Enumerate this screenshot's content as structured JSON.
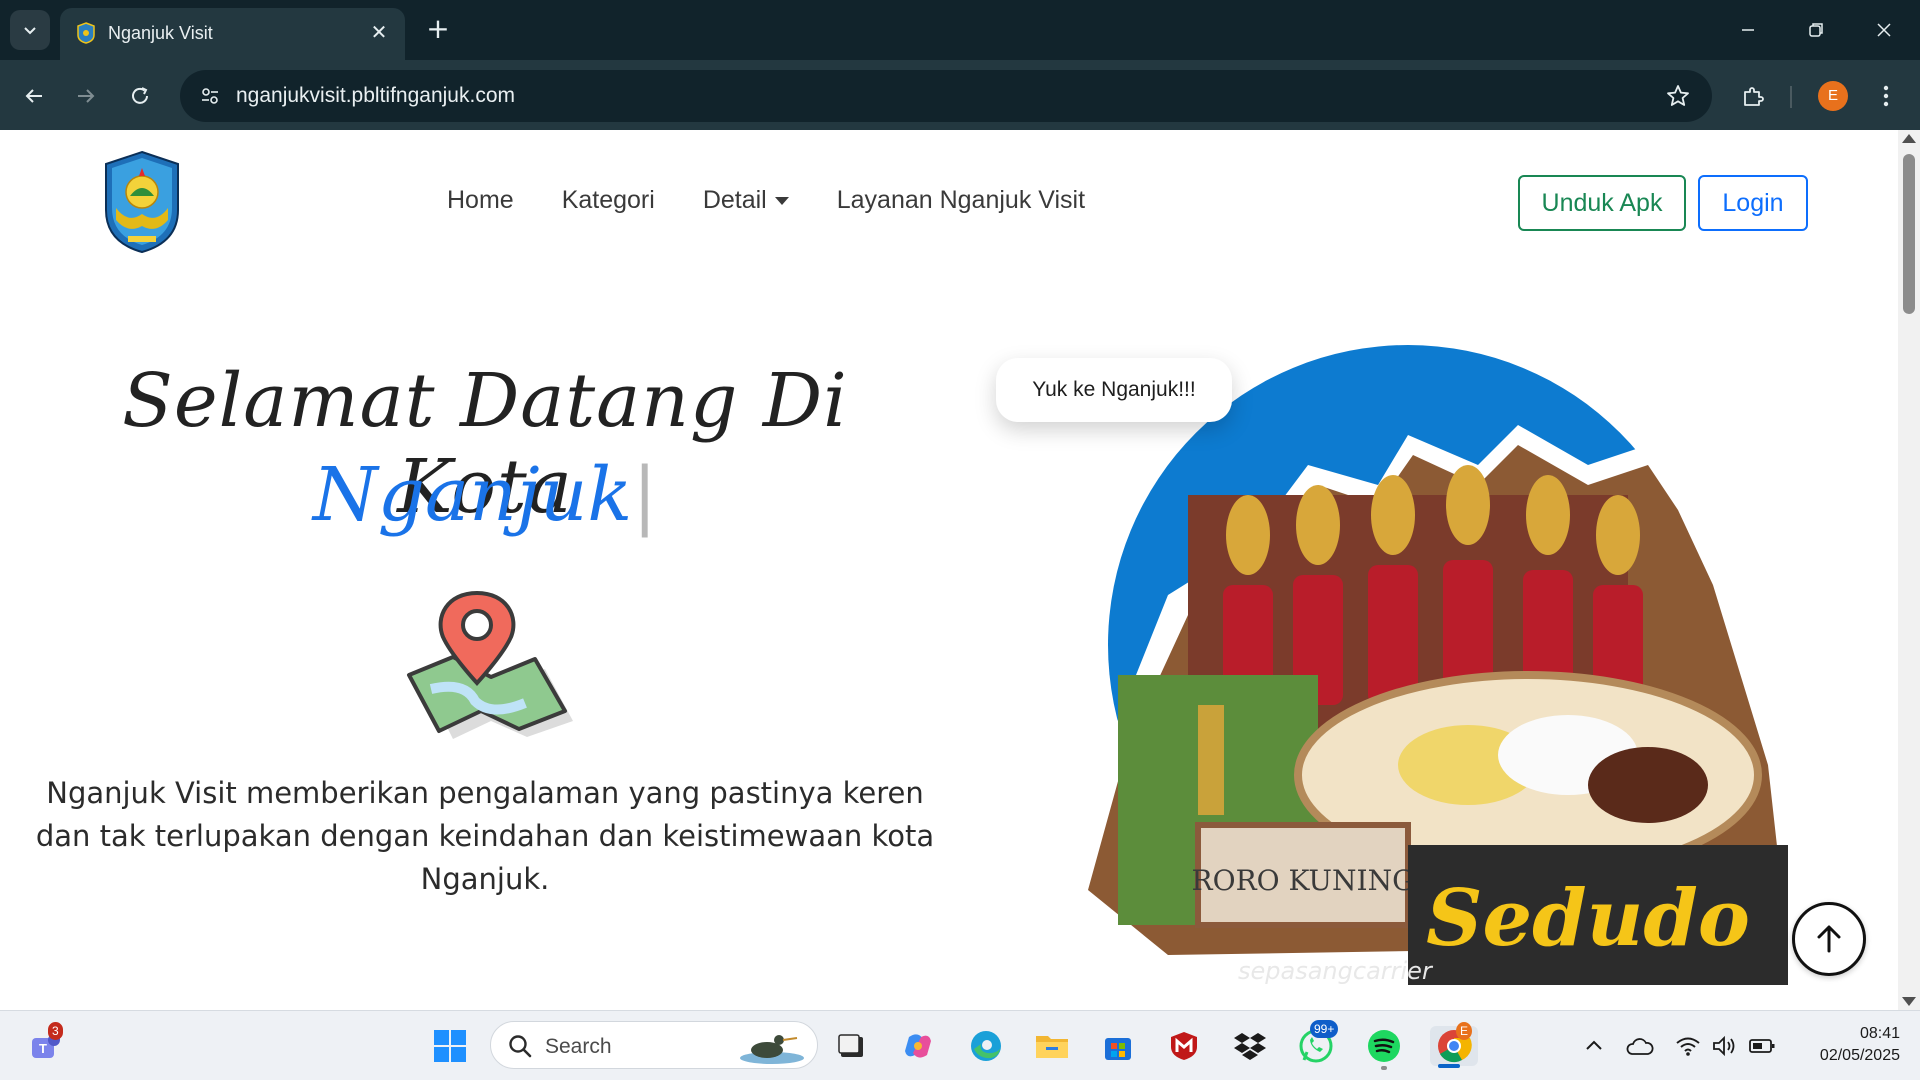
{
  "browser": {
    "tab_title": "Nganjuk Visit",
    "url": "nganjukvisit.pbltifnganjuk.com",
    "profile_initial": "E"
  },
  "site": {
    "nav": {
      "home": "Home",
      "kategori": "Kategori",
      "detail": "Detail",
      "layanan": "Layanan Nganjuk Visit"
    },
    "buttons": {
      "unduh": "Unduk Apk",
      "login": "Login"
    },
    "hero": {
      "title": "Selamat Datang Di Kota",
      "typed": "Nganjuk",
      "cursor": "|",
      "description": "Nganjuk Visit memberikan pengalaman yang pastinya keren dan tak terlupakan dengan keindahan dan keistimewaan kota Nganjuk.",
      "bubble": "Yuk ke Nganjuk!!!",
      "art_labels": {
        "sign": "RORO KUNING",
        "brand": "Sedudo",
        "watermark": "sepasangcarrier"
      }
    }
  },
  "taskbar": {
    "search_placeholder": "Search",
    "time": "08:41",
    "date": "02/05/2025",
    "badges": {
      "teams": "3",
      "whatsapp": "99+",
      "chrome": "E"
    }
  },
  "colors": {
    "primary": "#0d6efd",
    "success": "#198754",
    "typed_text": "#1a73e8",
    "chrome_dark": "#11232b",
    "chrome_toolbar": "#233840"
  }
}
